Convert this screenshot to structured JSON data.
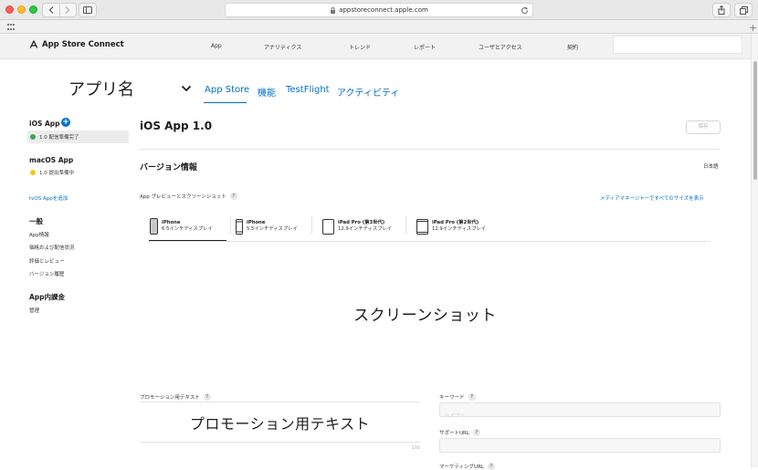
{
  "browser": {
    "url": "appstoreconnect.apple.com"
  },
  "header": {
    "logo_text": "App Store Connect",
    "nav": [
      "App",
      "アナリティクス",
      "トレンド",
      "レポート",
      "ユーザとアクセス",
      "契約"
    ]
  },
  "app": {
    "name": "アプリ名",
    "tabs": [
      "App Store",
      "機能",
      "TestFlight",
      "アクティビティ"
    ],
    "active_tab": "App Store"
  },
  "sidebar": {
    "ios_heading": "iOS App",
    "ios_version": "1.0 配信準備完了",
    "macos_heading": "macOS App",
    "macos_version": "1.0 提出準備中",
    "tvos_link": "tvOS Appを追加",
    "general_heading": "一般",
    "general_items": [
      "App情報",
      "価格および配信状況",
      "評価とレビュー",
      "バージョン履歴"
    ],
    "iap_heading": "App内課金",
    "iap_items": [
      "管理"
    ]
  },
  "main": {
    "title": "iOS App 1.0",
    "save_label": "保存",
    "version_info_heading": "バージョン情報",
    "language": "日本語",
    "preview_label": "App プレビューとスクリーンショット",
    "help_glyph": "?",
    "media_manager_link": "メディアマネージャーですべてのサイズを表示",
    "device_tabs": [
      {
        "name": "iPhone",
        "size": "6.5インチディスプレイ"
      },
      {
        "name": "iPhone",
        "size": "5.5インチディスプレイ"
      },
      {
        "name": "iPad Pro (第3世代)",
        "size": "12.9インチディスプレイ"
      },
      {
        "name": "iPad Pro (第2世代)",
        "size": "12.9インチディスプレイ"
      }
    ],
    "screenshot_placeholder": "スクリーンショット",
    "promo_label": "プロモーション用テキスト",
    "promo_placeholder": "プロモーション用テキスト",
    "promo_count": "170",
    "keyword_label": "キーワード",
    "keyword_placeholder": "ヘイワー",
    "support_url_label": "サポートURL",
    "marketing_url_label": "マーケティングURL"
  },
  "colors": {
    "link": "#0070c9",
    "ready": "#34a853",
    "pending": "#f5c518"
  }
}
